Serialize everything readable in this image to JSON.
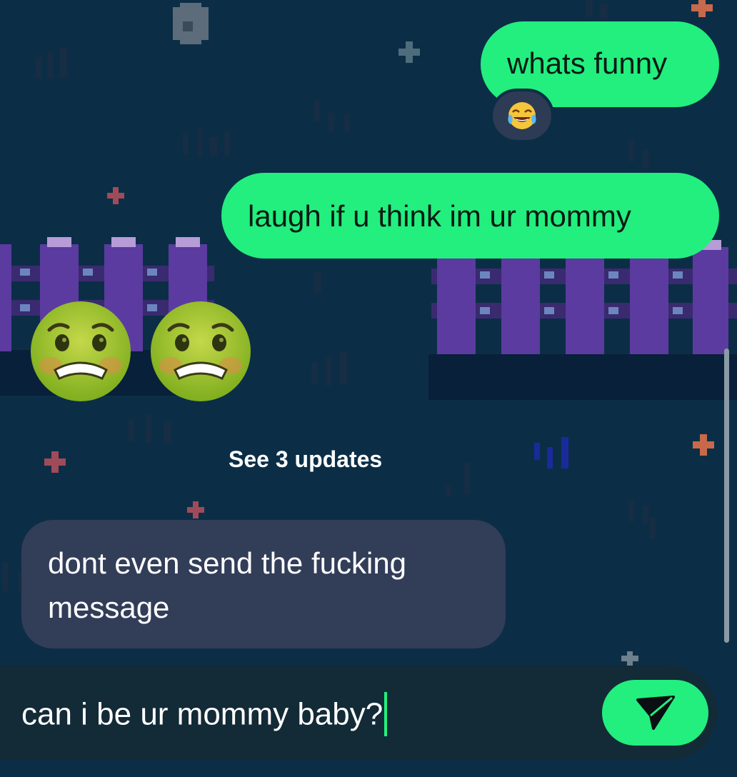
{
  "messages": [
    {
      "text": "whats funny",
      "direction": "outgoing",
      "reaction": "face-with-tears-of-joy"
    },
    {
      "text": "laugh if u think im ur mommy",
      "direction": "outgoing"
    },
    {
      "emoji": [
        "nauseated-face",
        "nauseated-face"
      ],
      "direction": "incoming"
    },
    {
      "text": "dont even send the fucking message",
      "direction": "incoming"
    }
  ],
  "updates_link": "See 3 updates",
  "composer": {
    "value": "can i be ur mommy baby?"
  },
  "colors": {
    "background": "#0b2e46",
    "outgoing_bubble": "#22ef7e",
    "incoming_bubble": "#323d58",
    "accent": "#22ef7e",
    "fence": "#5b3ba0"
  }
}
